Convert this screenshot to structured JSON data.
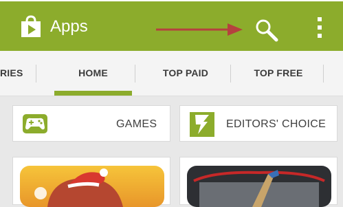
{
  "app_bar": {
    "title": "Apps",
    "color": "#8cac2c",
    "icons": [
      "play-store-bag-icon",
      "search-icon",
      "overflow-menu-icon"
    ]
  },
  "annotation": {
    "arrow_color": "#b5413e"
  },
  "tabs": [
    {
      "label": "RIES"
    },
    {
      "label": "HOME",
      "selected": true
    },
    {
      "label": "TOP PAID"
    },
    {
      "label": "TOP FREE"
    }
  ],
  "categories": [
    {
      "label": "GAMES",
      "icon": "gamepad-icon"
    },
    {
      "label": "EDITORS' CHOICE",
      "icon": "editors-choice-icon"
    }
  ],
  "app_cards": [
    {
      "icon": "game-app-icon"
    },
    {
      "icon": "hockey-app-icon"
    }
  ]
}
